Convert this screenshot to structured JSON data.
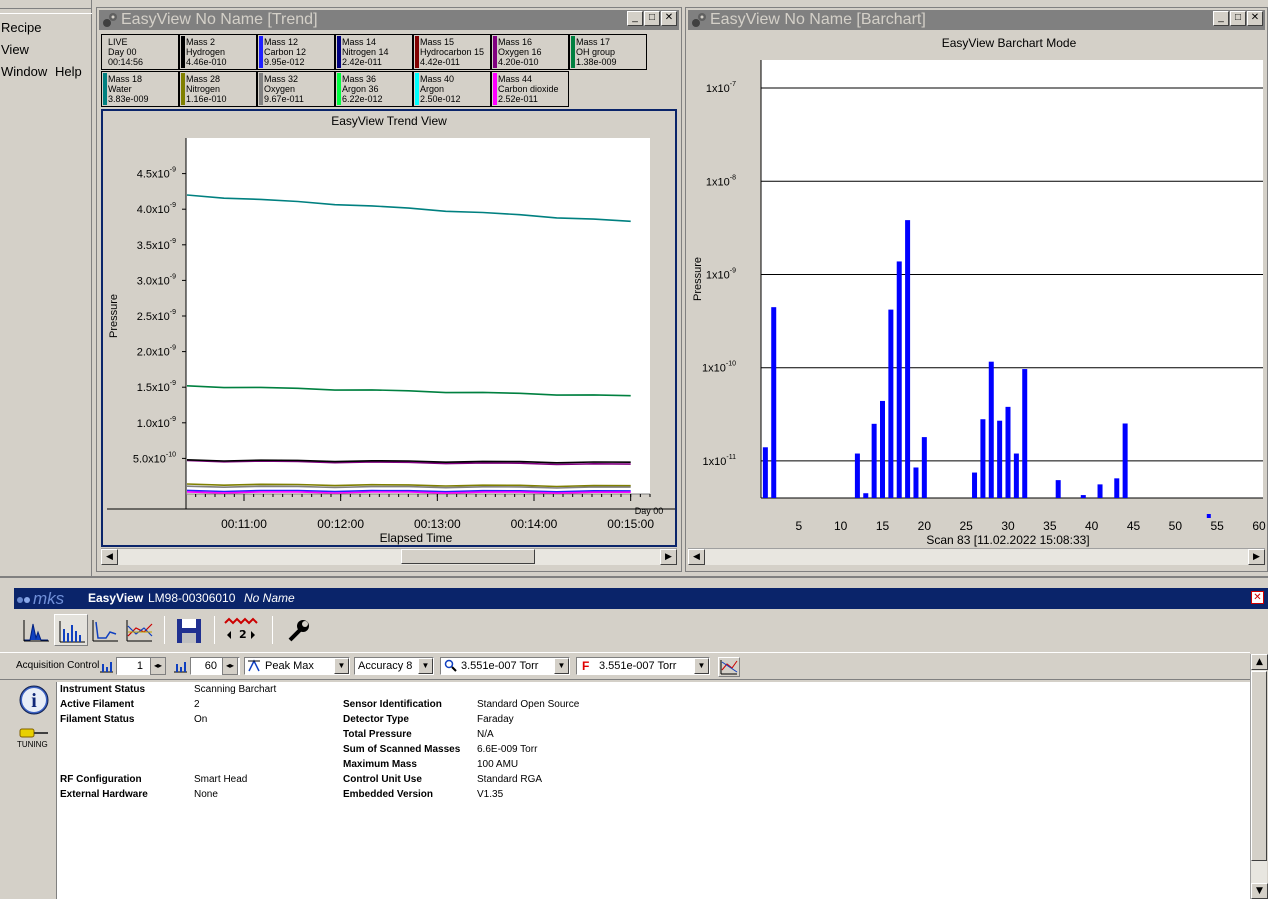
{
  "menu": [
    "Recipe",
    "View",
    "Window",
    "Help"
  ],
  "trend_window": {
    "title": "EasyView No Name [Trend]",
    "cells_row1": [
      {
        "l1": "LIVE",
        "l2": "Day 00",
        "l3": "00:14:56",
        "color": "#d4d0c8"
      },
      {
        "l1": "Mass 2",
        "l2": "Hydrogen",
        "l3": "4.46e-010",
        "color": "#000000"
      },
      {
        "l1": "Mass 12",
        "l2": "Carbon 12",
        "l3": "9.95e-012",
        "color": "#2020ff"
      },
      {
        "l1": "Mass 14",
        "l2": "Nitrogen 14",
        "l3": "2.42e-011",
        "color": "#000080"
      },
      {
        "l1": "Mass 15",
        "l2": "Hydrocarbon 15",
        "l3": "4.42e-011",
        "color": "#800000"
      },
      {
        "l1": "Mass 16",
        "l2": "Oxygen 16",
        "l3": "4.20e-010",
        "color": "#800080"
      },
      {
        "l1": "Mass 17",
        "l2": "OH group",
        "l3": "1.38e-009",
        "color": "#008040"
      }
    ],
    "cells_row2": [
      {
        "l1": "Mass 18",
        "l2": "Water",
        "l3": "3.83e-009",
        "color": "#008080"
      },
      {
        "l1": "Mass 28",
        "l2": "Nitrogen",
        "l3": "1.16e-010",
        "color": "#808000"
      },
      {
        "l1": "Mass 32",
        "l2": "Oxygen",
        "l3": "9.67e-011",
        "color": "#808080"
      },
      {
        "l1": "Mass 36",
        "l2": "Argon 36",
        "l3": "6.22e-012",
        "color": "#00ff40"
      },
      {
        "l1": "Mass 40",
        "l2": "Argon",
        "l3": "2.50e-012",
        "color": "#00ffff"
      },
      {
        "l1": "Mass 44",
        "l2": "Carbon dioxide",
        "l3": "2.52e-011",
        "color": "#ff00ff"
      }
    ]
  },
  "bar_window": {
    "title": "EasyView No Name [Barchart]"
  },
  "trend_chart": {
    "type": "line",
    "title": "EasyView Trend View",
    "xlabel": "Elapsed Time",
    "ylabel": "Pressure",
    "x_ticks": [
      "00:11:00",
      "00:12:00",
      "00:13:00",
      "00:14:00",
      "00:15:00"
    ],
    "x_end_label": "Day 00",
    "y_ticks": [
      "5.0x10",
      "1.0x10",
      "1.5x10",
      "2.0x10",
      "2.5x10",
      "3.0x10",
      "3.5x10",
      "4.0x10",
      "4.5x10"
    ],
    "y_tick_values": [
      5e-10,
      1e-09,
      1.5e-09,
      2e-09,
      2.5e-09,
      3e-09,
      3.5e-09,
      4e-09,
      4.5e-09
    ],
    "y_exp": [
      -10,
      -9,
      -9,
      -9,
      -9,
      -9,
      -9,
      -9,
      -9
    ],
    "ylim": [
      0,
      5e-09
    ],
    "x_range_min": [
      10.4,
      15.2
    ],
    "series": [
      {
        "color": "#008080",
        "start": 4.2e-09,
        "end": 3.83e-09
      },
      {
        "color": "#008040",
        "start": 1.52e-09,
        "end": 1.38e-09
      },
      {
        "color": "#800080",
        "start": 4.7e-10,
        "end": 4.2e-10
      },
      {
        "color": "#000000",
        "start": 4.8e-10,
        "end": 4.46e-10
      },
      {
        "color": "#808000",
        "start": 1.4e-10,
        "end": 1.16e-10
      },
      {
        "color": "#808080",
        "start": 1.1e-10,
        "end": 9.67e-11
      },
      {
        "color": "#2020ff",
        "start": 5e-11,
        "end": 4.4e-11
      },
      {
        "color": "#ff00ff",
        "start": 3e-11,
        "end": 2.52e-11
      }
    ]
  },
  "bar_chart": {
    "type": "bar",
    "title": "EasyView Barchart Mode",
    "xlabel": "Scan 83 [11.02.2022 15:08:33]",
    "ylabel": "Pressure",
    "y_scale": "log",
    "ylim": [
      4e-12,
      2e-07
    ],
    "y_ticks_exp": [
      -11,
      -10,
      -9,
      -8,
      -7
    ],
    "y_tick_base": "1x10",
    "x_ticks": [
      "5",
      "10",
      "15",
      "20",
      "25",
      "30",
      "35",
      "40",
      "45",
      "50",
      "55",
      "60"
    ],
    "x_tick_values": [
      5,
      10,
      15,
      20,
      25,
      30,
      35,
      40,
      45,
      50,
      55,
      60
    ],
    "xlim": [
      0,
      60
    ],
    "color": "#0000ff",
    "masses": [
      1,
      2,
      12,
      13,
      14,
      15,
      16,
      17,
      18,
      19,
      20,
      26,
      27,
      28,
      29,
      30,
      31,
      32,
      36,
      39,
      41,
      43,
      44
    ],
    "values": [
      1.4e-11,
      4.46e-10,
      1.2e-11,
      4.5e-12,
      2.5e-11,
      4.4e-11,
      4.2e-10,
      1.38e-09,
      3.83e-09,
      8.5e-12,
      1.8e-11,
      7.5e-12,
      2.8e-11,
      1.16e-10,
      2.7e-11,
      3.8e-11,
      1.2e-11,
      9.67e-11,
      6.22e-12,
      4.3e-12,
      5.6e-12,
      6.5e-12,
      2.52e-11
    ]
  },
  "bottom": {
    "brand": "mks",
    "app_name": "EasyView",
    "device": "LM98-00306010",
    "doc_name": "No Name",
    "acq_label": "Acquisition Control",
    "start_mass": "1",
    "end_mass": "60",
    "mode": "Peak Max",
    "accuracy": "Accuracy 8",
    "pressure1": "3.551e-007 Torr",
    "pressure2": "3.551e-007 Torr",
    "tuning": "TUNING",
    "tb_num": "2",
    "status_left": [
      {
        "label": "Instrument Status",
        "value": "Scanning Barchart"
      },
      {
        "label": "Active Filament",
        "value": "2"
      },
      {
        "label": "Filament Status",
        "value": "On"
      },
      {
        "label": "RF Configuration",
        "value": "Smart Head"
      },
      {
        "label": "External Hardware",
        "value": "None"
      }
    ],
    "status_right": [
      {
        "label": "Sensor Identification",
        "value": "Standard Open Source"
      },
      {
        "label": "Detector Type",
        "value": "Faraday"
      },
      {
        "label": "Total Pressure",
        "value": "N/A"
      },
      {
        "label": "Sum of Scanned Masses",
        "value": "6.6E-009 Torr"
      },
      {
        "label": "Maximum Mass",
        "value": "100 AMU"
      },
      {
        "label": "Control Unit Use",
        "value": "Standard RGA"
      },
      {
        "label": "Embedded Version",
        "value": "V1.35"
      }
    ]
  }
}
